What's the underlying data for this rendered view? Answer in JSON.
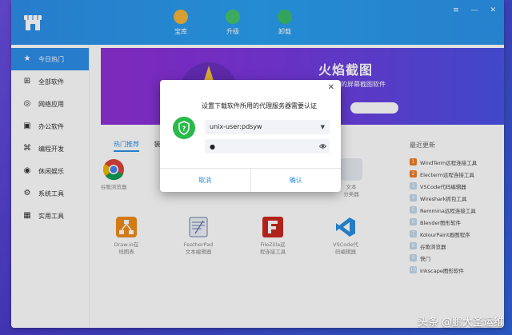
{
  "topbar": {
    "buttons": [
      {
        "label": "宝库",
        "icon": "star-icon",
        "color": "#f5b43a"
      },
      {
        "label": "升级",
        "icon": "up-arrow-icon",
        "color": "#46c36a"
      },
      {
        "label": "卸载",
        "icon": "trash-icon",
        "color": "#3bbb6a"
      }
    ],
    "controls": [
      "≡",
      "—",
      "✕"
    ]
  },
  "sidebar": {
    "items": [
      {
        "label": "今日热门",
        "icon": "star-icon",
        "glyph": "★"
      },
      {
        "label": "全部软件",
        "icon": "grid-icon",
        "glyph": "⊞"
      },
      {
        "label": "网络应用",
        "icon": "globe-icon",
        "glyph": "◎"
      },
      {
        "label": "办公软件",
        "icon": "briefcase-icon",
        "glyph": "▣"
      },
      {
        "label": "编程开发",
        "icon": "code-icon",
        "glyph": "⌘"
      },
      {
        "label": "休闲娱乐",
        "icon": "game-icon",
        "glyph": "◉"
      },
      {
        "label": "系统工具",
        "icon": "gear-icon",
        "glyph": "⚙"
      },
      {
        "label": "实用工具",
        "icon": "calendar-icon",
        "glyph": "▦"
      }
    ]
  },
  "banner": {
    "title": "火焰截图",
    "subtitle": "用的屏幕截图软件"
  },
  "tabs": [
    "热门推荐",
    "装机必"
  ],
  "apps": {
    "row1": [
      {
        "name": "谷歌浏览器",
        "icon": "chrome-icon"
      },
      {
        "name": "文本\n分类器",
        "icon": "text-icon"
      }
    ],
    "row2": [
      {
        "name": "Draw.io在\n线图表",
        "icon": "drawio-icon",
        "color": "#f08c1a"
      },
      {
        "name": "FeatherPad\n文本编辑器",
        "icon": "featherpad-icon",
        "color": "#6a7ea8"
      },
      {
        "name": "FileZilla远\n程连接工具",
        "icon": "filezilla-icon",
        "color": "#c8281e"
      },
      {
        "name": "VSCode代\n码编辑器",
        "icon": "vscode-icon",
        "color": "#2a8fe0"
      }
    ]
  },
  "recent": {
    "title": "最近更新",
    "items": [
      {
        "num": "1",
        "label": "WindTerm远程连接工具"
      },
      {
        "num": "2",
        "label": "Electerm远程连接工具"
      },
      {
        "num": "3",
        "label": "VSCode代码编辑器"
      },
      {
        "num": "4",
        "label": "Wireshark抓包工具"
      },
      {
        "num": "5",
        "label": "Remmina远程连接工具"
      },
      {
        "num": "6",
        "label": "Blender图形软件"
      },
      {
        "num": "7",
        "label": "KolourPaint画图程序"
      },
      {
        "num": "8",
        "label": "谷歌浏览器"
      },
      {
        "num": "9",
        "label": "快门"
      },
      {
        "num": "10",
        "label": "Inkscape图形软件"
      }
    ]
  },
  "dialog": {
    "message": "设置下载软件所用的代理服务器需要认证",
    "username": "unix-user:pdsyw",
    "password": "●",
    "cancel": "取消",
    "confirm": "确认"
  },
  "watermark": "头条 @鹏大圣运维",
  "colors": {
    "accent": "#2d8ee8",
    "shield": "#2ab94b"
  }
}
